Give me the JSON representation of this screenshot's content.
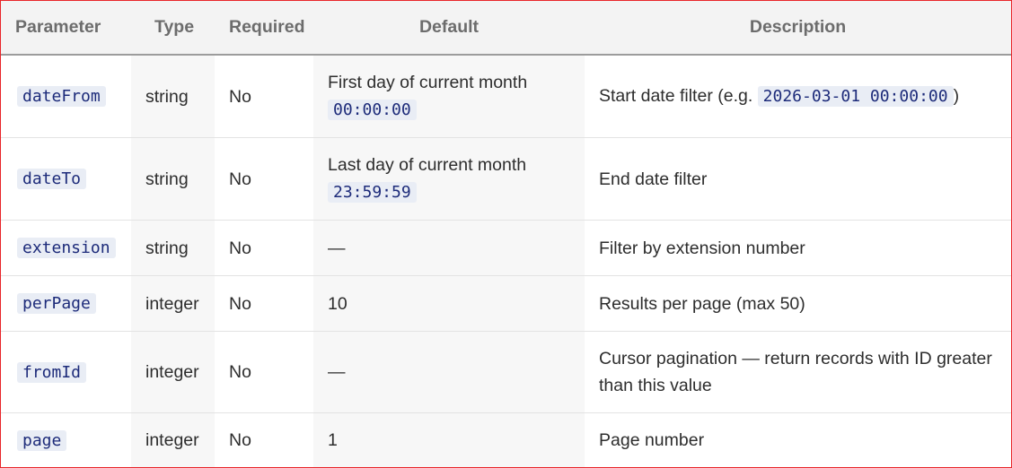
{
  "table": {
    "headers": [
      "Parameter",
      "Type",
      "Required",
      "Default",
      "Description"
    ],
    "rows": [
      {
        "name": "dateFrom",
        "type": "string",
        "required": "No",
        "default_text": "First day of current month",
        "default_code": "00:00:00",
        "desc_text": "Start date filter (e.g.",
        "desc_code": "2026-03-01 00:00:00",
        "desc_after": ")"
      },
      {
        "name": "dateTo",
        "type": "string",
        "required": "No",
        "default_text": "Last day of current month",
        "default_code": "23:59:59",
        "desc_text": "End date filter"
      },
      {
        "name": "extension",
        "type": "string",
        "required": "No",
        "default_text": "—",
        "desc_text": "Filter by extension number"
      },
      {
        "name": "perPage",
        "type": "integer",
        "required": "No",
        "default_text": "10",
        "desc_text": "Results per page (max 50)"
      },
      {
        "name": "fromId",
        "type": "integer",
        "required": "No",
        "default_text": "—",
        "desc_text": "Cursor pagination — return records with ID greater than this value"
      },
      {
        "name": "page",
        "type": "integer",
        "required": "No",
        "default_text": "1",
        "desc_text": "Page number"
      }
    ]
  },
  "colors": {
    "frame_border": "#e8262a",
    "header_bg": "#f3f3f3",
    "header_text": "#6c6c6c",
    "code_text": "#1d2b7a",
    "code_bg": "#e9edf5"
  }
}
